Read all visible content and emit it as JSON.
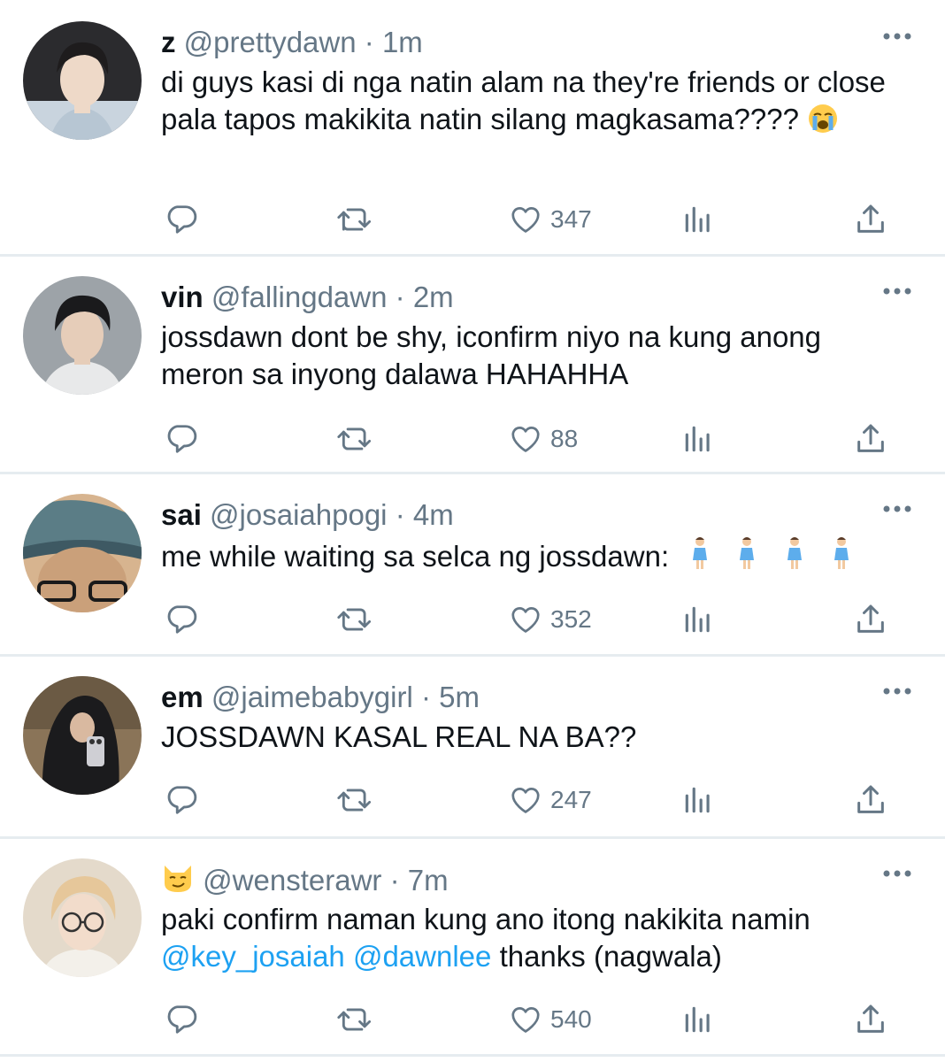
{
  "tweets": [
    {
      "display_name": "z",
      "handle": "@prettydawn",
      "separator": "·",
      "time": "1m",
      "text": "di guys kasi di nga natin alam na they're friends or close pala tapos makikita natin silang magkasama????",
      "emoji_icon": "loudly-crying-face-icon",
      "likes": "347",
      "avatar_bg": "#c9d4de"
    },
    {
      "display_name": "vin",
      "handle": "@fallingdawn",
      "separator": "·",
      "time": "2m",
      "text": "jossdawn dont be shy, iconfirm niyo na kung anong meron sa inyong dalawa HAHAHHA",
      "likes": "88",
      "avatar_bg": "#b8bec4"
    },
    {
      "display_name": "sai",
      "handle": "@josaiahpogi",
      "separator": "·",
      "time": "4m",
      "text": "me while waiting sa selca ng jossdawn:",
      "emoji_icon": "standing-woman-icon",
      "likes": "352",
      "avatar_bg": "#5b7d86"
    },
    {
      "display_name": "em",
      "handle": "@jaimebabygirl",
      "separator": "·",
      "time": "5m",
      "text": "JOSSDAWN KASAL REAL NA BA??",
      "likes": "247",
      "avatar_bg": "#6b5a44"
    },
    {
      "display_name": "",
      "name_emoji_icon": "smirking-cat-icon",
      "handle": "@wensterawr",
      "separator": "·",
      "time": "7m",
      "text": "paki confirm naman kung ano itong nakikita namin",
      "mention_1": "@key_josaiah",
      "mention_2": "@dawnlee",
      "text_tail": "thanks (nagwala)",
      "likes": "540",
      "avatar_bg": "#d8cbb8"
    }
  ],
  "colors": {
    "text": "#0f1419",
    "muted": "#657786",
    "link": "#1da1f2",
    "divider": "#e6ecf0"
  },
  "icons": {
    "reply": "reply-icon",
    "retweet": "retweet-icon",
    "like": "heart-icon",
    "analytics": "analytics-icon",
    "share": "share-icon",
    "more": "more-options-icon"
  }
}
